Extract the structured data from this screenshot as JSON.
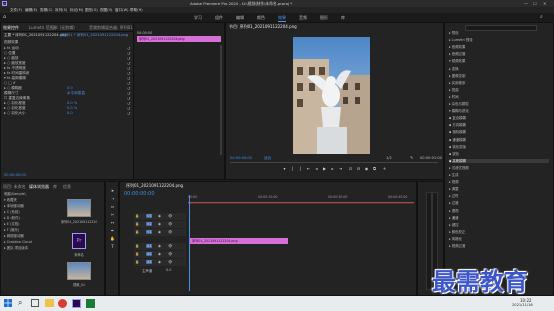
{
  "app": {
    "title": "Adobe Premiere Pro 2020 - D:\\视频\\制作\\未命名.prproj *",
    "min": "—",
    "max": "☐",
    "close": "✕"
  },
  "menu": [
    "文件(F)",
    "编辑(E)",
    "剪辑(C)",
    "序列(S)",
    "标记(M)",
    "图形(G)",
    "视图(V)",
    "窗口(W)",
    "帮助(H)"
  ],
  "workspaces": [
    "学习",
    "组件",
    "编辑",
    "颜色",
    "效果",
    "音频",
    "图形",
    "库"
  ],
  "active_workspace": "效果",
  "source_panel": {
    "tabs": [
      "效果控件",
      "Lumetri 范围",
      "源: (无剪辑)",
      "音频剪辑混合器: 序列01"
    ],
    "master": "主要 * 序列01_2021091122204.png",
    "seq": "序列01 * 序列01_2021091122204.png",
    "timecode": "00:00:00",
    "clip_label": "序列01_2021091122204.png",
    "rows": [
      {
        "label": "▸ fx 运动",
        "val": ""
      },
      {
        "label": "  ○ 位置",
        "val": ""
      },
      {
        "label": "  ▸ ○ 缩放",
        "val": ""
      },
      {
        "label": "  ▸ ○ 缩放宽度",
        "val": ""
      },
      {
        "label": "▸ fx 不透明度",
        "val": ""
      },
      {
        "label": "▸ fx 时间重映射",
        "val": ""
      },
      {
        "label": "▾ fx 高斯模糊",
        "val": ""
      },
      {
        "label": "  ○ □ ✐",
        "val": ""
      },
      {
        "label": "  ▸ ○ 模糊度",
        "val": "0.0"
      },
      {
        "label": "     模糊尺寸",
        "val": "水平和垂直"
      },
      {
        "label": "     ☐ 重复边缘像素",
        "val": ""
      },
      {
        "label": "  ▸ ○ 羽化程度",
        "val": "0.0 %"
      },
      {
        "label": "  ▸ ○ 羽化宽度",
        "val": "0.0 %"
      },
      {
        "label": "  ▸ ○ 羽化大小",
        "val": "0.0"
      }
    ],
    "footer_tc": "00:00:00:00"
  },
  "program": {
    "tab": "节目: 序列01_2021091122204.png",
    "tc_left": "00:00:00:00",
    "fit": "适合",
    "ratio": "1/2",
    "tc_right": "00:00:01:00"
  },
  "project": {
    "tabs": [
      "项目: 未命名",
      "媒体浏览器",
      "库",
      "信息"
    ],
    "path": "电脑\\Sample\\",
    "tree": [
      "▾ 收藏夹",
      "  ▸ 本地驱动器",
      "   ▸ C (系统)",
      "   ▸ D (软件)",
      "   ▸ E (文档)",
      "   ▸ F (娱乐)",
      "▸ 网络驱动器",
      "▸ Creative Cloud",
      "  ▸ 团队 项目版本"
    ],
    "thumbs": [
      {
        "label": "序列01_202109112220...",
        "type": "photo"
      },
      {
        "label": "未命名",
        "type": "prproj"
      },
      {
        "label": "视频_01",
        "type": "photo2"
      }
    ]
  },
  "timeline": {
    "tab": "序列01_2021091122204.png",
    "tc": "00:00:00:00",
    "ruler": [
      "00:00",
      "00:00:15:00",
      "00:00:30:00",
      "00:00:45:00"
    ],
    "tracks": [
      "V3",
      "V2",
      "V1",
      "A1",
      "A2",
      "A3"
    ],
    "master": "主声道",
    "master_val": "0.0",
    "clip": "序列01_2021091122204.png"
  },
  "effects_panel": {
    "tree": [
      "▸ 预设",
      "▸ Lumetri 预设",
      "▸ 音频效果",
      "▸ 音频过渡",
      "▾ 视频效果",
      "  ▸ 变换",
      "  ▸ 图像控制",
      "  ▸ 实用程序",
      "  ▸ 扭曲",
      "  ▸ 时间",
      "  ▸ 杂色与颗粒",
      "  ▾ 模糊与锐化",
      "    ▪ 复合模糊",
      "    ▪ 方向模糊",
      "    ▪ 相机模糊",
      "    ▪ 通道模糊",
      "    ▪ 钝化蒙版",
      "    ▪ 锐化",
      "    ▪ 高斯模糊",
      "  ▸ 沉浸式视频",
      "  ▸ 生成",
      "  ▸ 视频",
      "  ▸ 调整",
      "  ▸ 过时",
      "  ▸ 过渡",
      "  ▸ 透视",
      "  ▸ 通道",
      "  ▸ 键控",
      "  ▸ 颜色校正",
      "  ▸ 风格化",
      "▸ 视频过渡"
    ],
    "selected": "    ▪ 高斯模糊"
  },
  "watermark": "最需教育",
  "taskbar": {
    "time": "10:22",
    "date": "2021/11/16"
  },
  "colors": {
    "accent": "#3f8fe6",
    "clip": "#d66fd6",
    "playhead": "#e02d2d"
  }
}
